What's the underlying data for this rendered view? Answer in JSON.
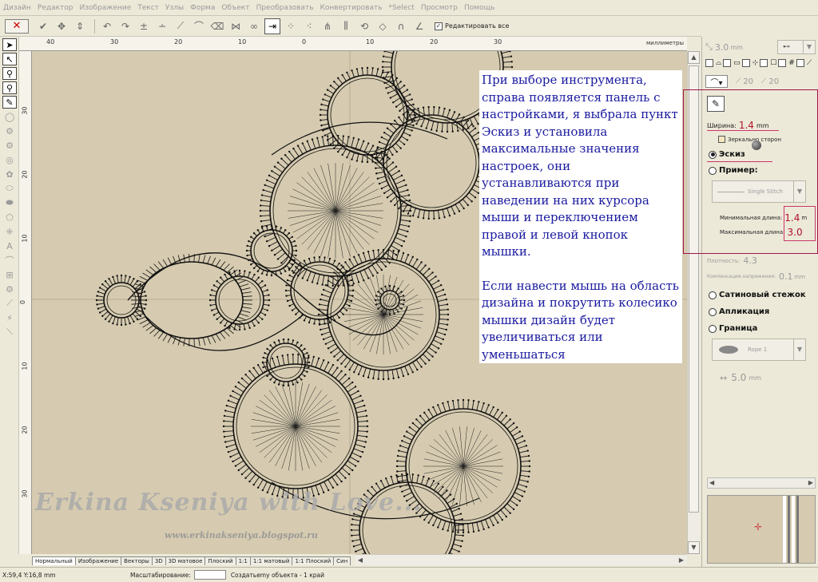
{
  "menu": [
    "Дизайн",
    "Редактор",
    "Изображение",
    "Текст",
    "Узлы",
    "Форма",
    "Объект",
    "Преобразовать",
    "Конвертировать",
    "*Select",
    "Просмотр",
    "Помощь"
  ],
  "toolbar": {
    "close_label": "✕",
    "edit_all_checked": "✓",
    "edit_all_label": "Редактировать все"
  },
  "ruler": {
    "units": "миллиметры",
    "top_ticks": [
      "40",
      "30",
      "20",
      "10",
      "0",
      "10",
      "20",
      "30"
    ],
    "left_ticks": [
      "30",
      "20",
      "10",
      "0",
      "10",
      "20",
      "30"
    ]
  },
  "note": {
    "paragraph1": "При выборе инструмента, справа появляется панель с настройками, я выбрала пункт Эскиз и установила максимальные значения настроек, они устанавливаются при наведении на них курсора мыши и переключением правой и левой кнопок мышки.",
    "paragraph2": "Если навести мышь на область дизайна и покрутить колесико мышки дизайн будет увеличиваться или уменьшаться"
  },
  "watermark": {
    "line1": "Erkina Kseniya with Love...",
    "line2": "www.erkinakseniya.blogspot.ru"
  },
  "view_tabs": [
    "Нормальный",
    "Изображение",
    "Векторы",
    "3D",
    "3D матовое",
    "Плоский",
    "1:1",
    "1:1 матовый",
    "1:1 Плоский",
    "Син"
  ],
  "status": {
    "coords": "X:59,4  Y:16,8 mm",
    "zoom_label": "Масштабирование:",
    "hint": "Создатьemy объекта - 1 край"
  },
  "panel": {
    "top_value": "3.0",
    "top_unit": "mm",
    "angle1": "20",
    "angle2": "20",
    "width_label": "Ширина:",
    "width_value": "1.4",
    "width_unit": "mm",
    "mirror_label": "Зеркально сторон",
    "sketch_label": "Эскиз",
    "example_label": "Пример:",
    "stitch_option": "Single Stitch",
    "min_len_label": "Минимальная длина:",
    "min_len_value": "1.4",
    "min_len_unit": "m",
    "max_len_label": "Максимальная длина:",
    "max_len_value": "3.0",
    "density_label": "Плотность:",
    "density_value": "4.3",
    "comp_label": "Компенсация напряжения:",
    "comp_value": "0.1",
    "comp_unit": "mm",
    "satin_label": "Сатиновый стежок",
    "applique_label": "Апликация",
    "border_label": "Граница",
    "rope_option": "Rope 1",
    "rope_width": "5.0",
    "rope_unit": "mm"
  },
  "colors": {
    "canvas": "#d6cbb0",
    "note_text": "#1a1aa0",
    "highlight": "#a0134a",
    "value_red": "#b3102d"
  }
}
